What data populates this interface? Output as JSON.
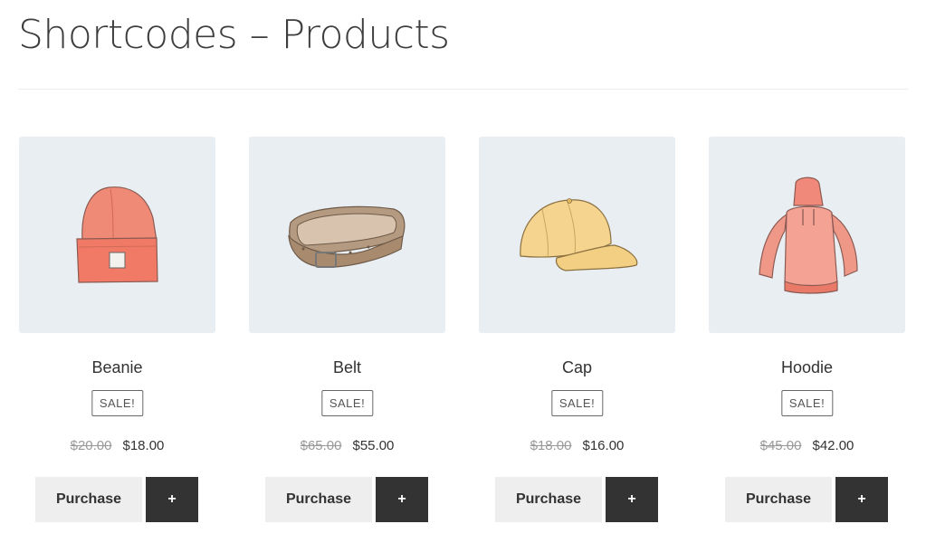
{
  "page": {
    "title": "Shortcodes – Products"
  },
  "products": [
    {
      "name": "Beanie",
      "badge": "SALE!",
      "regular_price": "$20.00",
      "sale_price": "$18.00",
      "purchase_label": "Purchase",
      "add_label": "+",
      "image": "beanie-image"
    },
    {
      "name": "Belt",
      "badge": "SALE!",
      "regular_price": "$65.00",
      "sale_price": "$55.00",
      "purchase_label": "Purchase",
      "add_label": "+",
      "image": "belt-image"
    },
    {
      "name": "Cap",
      "badge": "SALE!",
      "regular_price": "$18.00",
      "sale_price": "$16.00",
      "purchase_label": "Purchase",
      "add_label": "+",
      "image": "cap-image"
    },
    {
      "name": "Hoodie",
      "badge": "SALE!",
      "regular_price": "$45.00",
      "sale_price": "$42.00",
      "purchase_label": "Purchase",
      "add_label": "+",
      "image": "hoodie-image"
    }
  ],
  "colors": {
    "thumb_background": "#e9eef3",
    "purchase_button": "#eeeeee",
    "add_button": "#333333"
  }
}
